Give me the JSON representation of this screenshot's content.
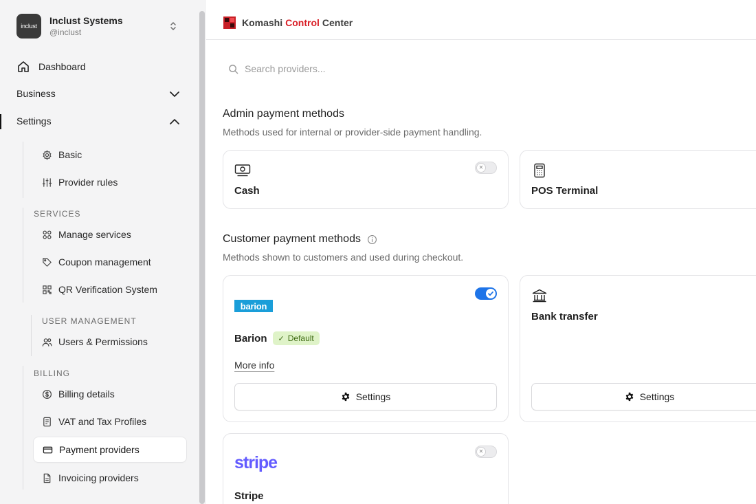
{
  "org": {
    "logo_text": "inclust",
    "name": "Inclust Systems",
    "handle": "@inclust"
  },
  "nav": {
    "dashboard": "Dashboard",
    "business": "Business",
    "settings": "Settings",
    "basic": "Basic",
    "provider_rules": "Provider rules",
    "services_title": "SERVICES",
    "manage_services": "Manage services",
    "coupon_management": "Coupon management",
    "qr_verification": "QR Verification System",
    "user_management_title": "USER MANAGEMENT",
    "users_permissions": "Users & Permissions",
    "billing_title": "BILLING",
    "billing_details": "Billing details",
    "vat_tax_profiles": "VAT and Tax Profiles",
    "payment_providers": "Payment providers",
    "invoicing_providers": "Invoicing providers"
  },
  "brand": {
    "part1": "Komashi",
    "part2": "Control",
    "part3": "Center",
    "accent_color": "#d91e26"
  },
  "search": {
    "placeholder": "Search providers..."
  },
  "admin_section": {
    "title": "Admin payment methods",
    "description": "Methods used for internal or provider-side payment handling.",
    "cards": [
      {
        "name": "Cash",
        "icon": "cash-icon",
        "enabled": false
      },
      {
        "name": "POS Terminal",
        "icon": "calculator-icon"
      }
    ]
  },
  "customer_section": {
    "title": "Customer payment methods",
    "description": "Methods shown to customers and used during checkout.",
    "cards": [
      {
        "name": "Barion",
        "logo_text": "barion",
        "badge": "Default",
        "badge_check": "✓",
        "link": "More info",
        "button": "Settings",
        "enabled": true
      },
      {
        "name": "Bank transfer",
        "icon": "bank-icon",
        "button": "Settings"
      },
      {
        "name": "Stripe",
        "logo_text": "stripe",
        "enabled": false
      }
    ]
  },
  "colors": {
    "toggle_on": "#1e74e8",
    "barion_blue": "#1a9ed9",
    "stripe_purple": "#635bff",
    "default_badge_bg": "#dff3c8"
  }
}
